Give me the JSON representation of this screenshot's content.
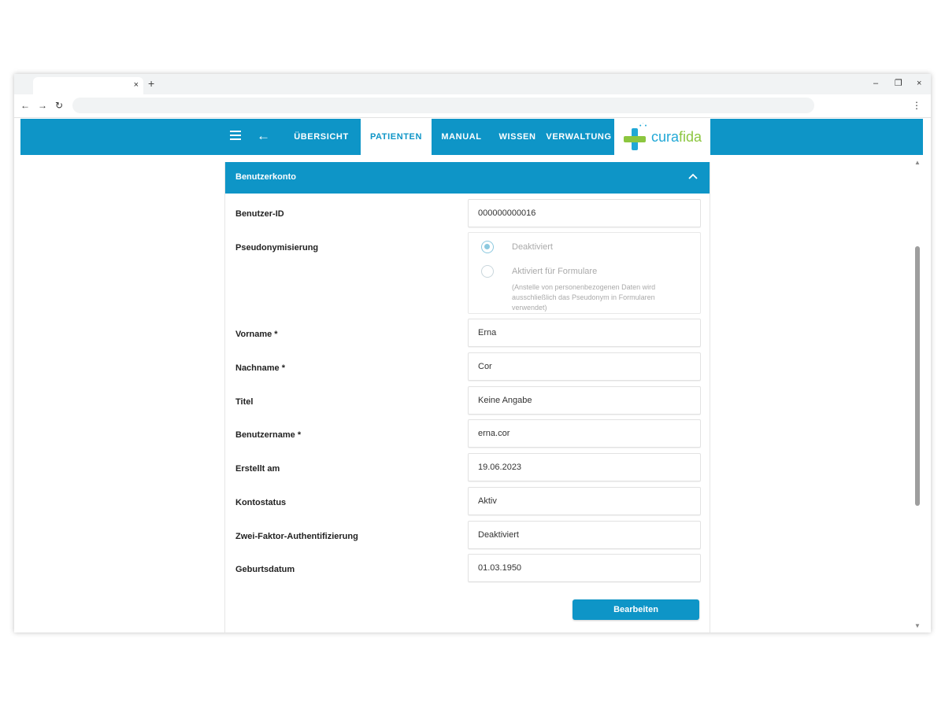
{
  "browser": {
    "tab_close": "×",
    "new_tab": "+",
    "minimize": "–",
    "restore": "❐",
    "close": "×",
    "back": "←",
    "forward": "→",
    "reload": "↻",
    "address": "",
    "menu": "⋮"
  },
  "appbar": {
    "color": "#0e95c7",
    "nav": [
      {
        "label": "ÜBERSICHT"
      },
      {
        "label": "PATIENTEN"
      },
      {
        "label": "MANUAL"
      },
      {
        "label": "WISSEN"
      },
      {
        "label": "VERWALTUNG"
      }
    ],
    "active_nav": "PATIENTEN",
    "logo": {
      "part1": "cura",
      "part2": "fida",
      "dots": "•˙•"
    }
  },
  "card": {
    "title": "Benutzerkonto",
    "fields": [
      {
        "label": "Benutzer-ID",
        "value": "000000000016"
      },
      {
        "label": "Vorname *",
        "value": "Erna"
      },
      {
        "label": "Nachname *",
        "value": "Cor"
      },
      {
        "label": "Titel",
        "value": "Keine Angabe"
      },
      {
        "label": "Benutzername *",
        "value": "erna.cor"
      },
      {
        "label": "Erstellt am",
        "value": "19.06.2023"
      },
      {
        "label": "Kontostatus",
        "value": "Aktiv"
      },
      {
        "label": "Zwei-Faktor-Authentifizierung",
        "value": "Deaktiviert"
      },
      {
        "label": "Geburtsdatum",
        "value": "01.03.1950"
      }
    ],
    "pseudonym": {
      "label": "Pseudonymisierung",
      "options": [
        {
          "label": "Deaktiviert",
          "checked": true
        },
        {
          "label": "Aktiviert für Formulare",
          "checked": false
        }
      ],
      "hint": "(Anstelle von personenbezogenen Daten wird ausschließlich das Pseudonym in Formularen verwendet)"
    },
    "edit_button": "Bearbeiten"
  }
}
